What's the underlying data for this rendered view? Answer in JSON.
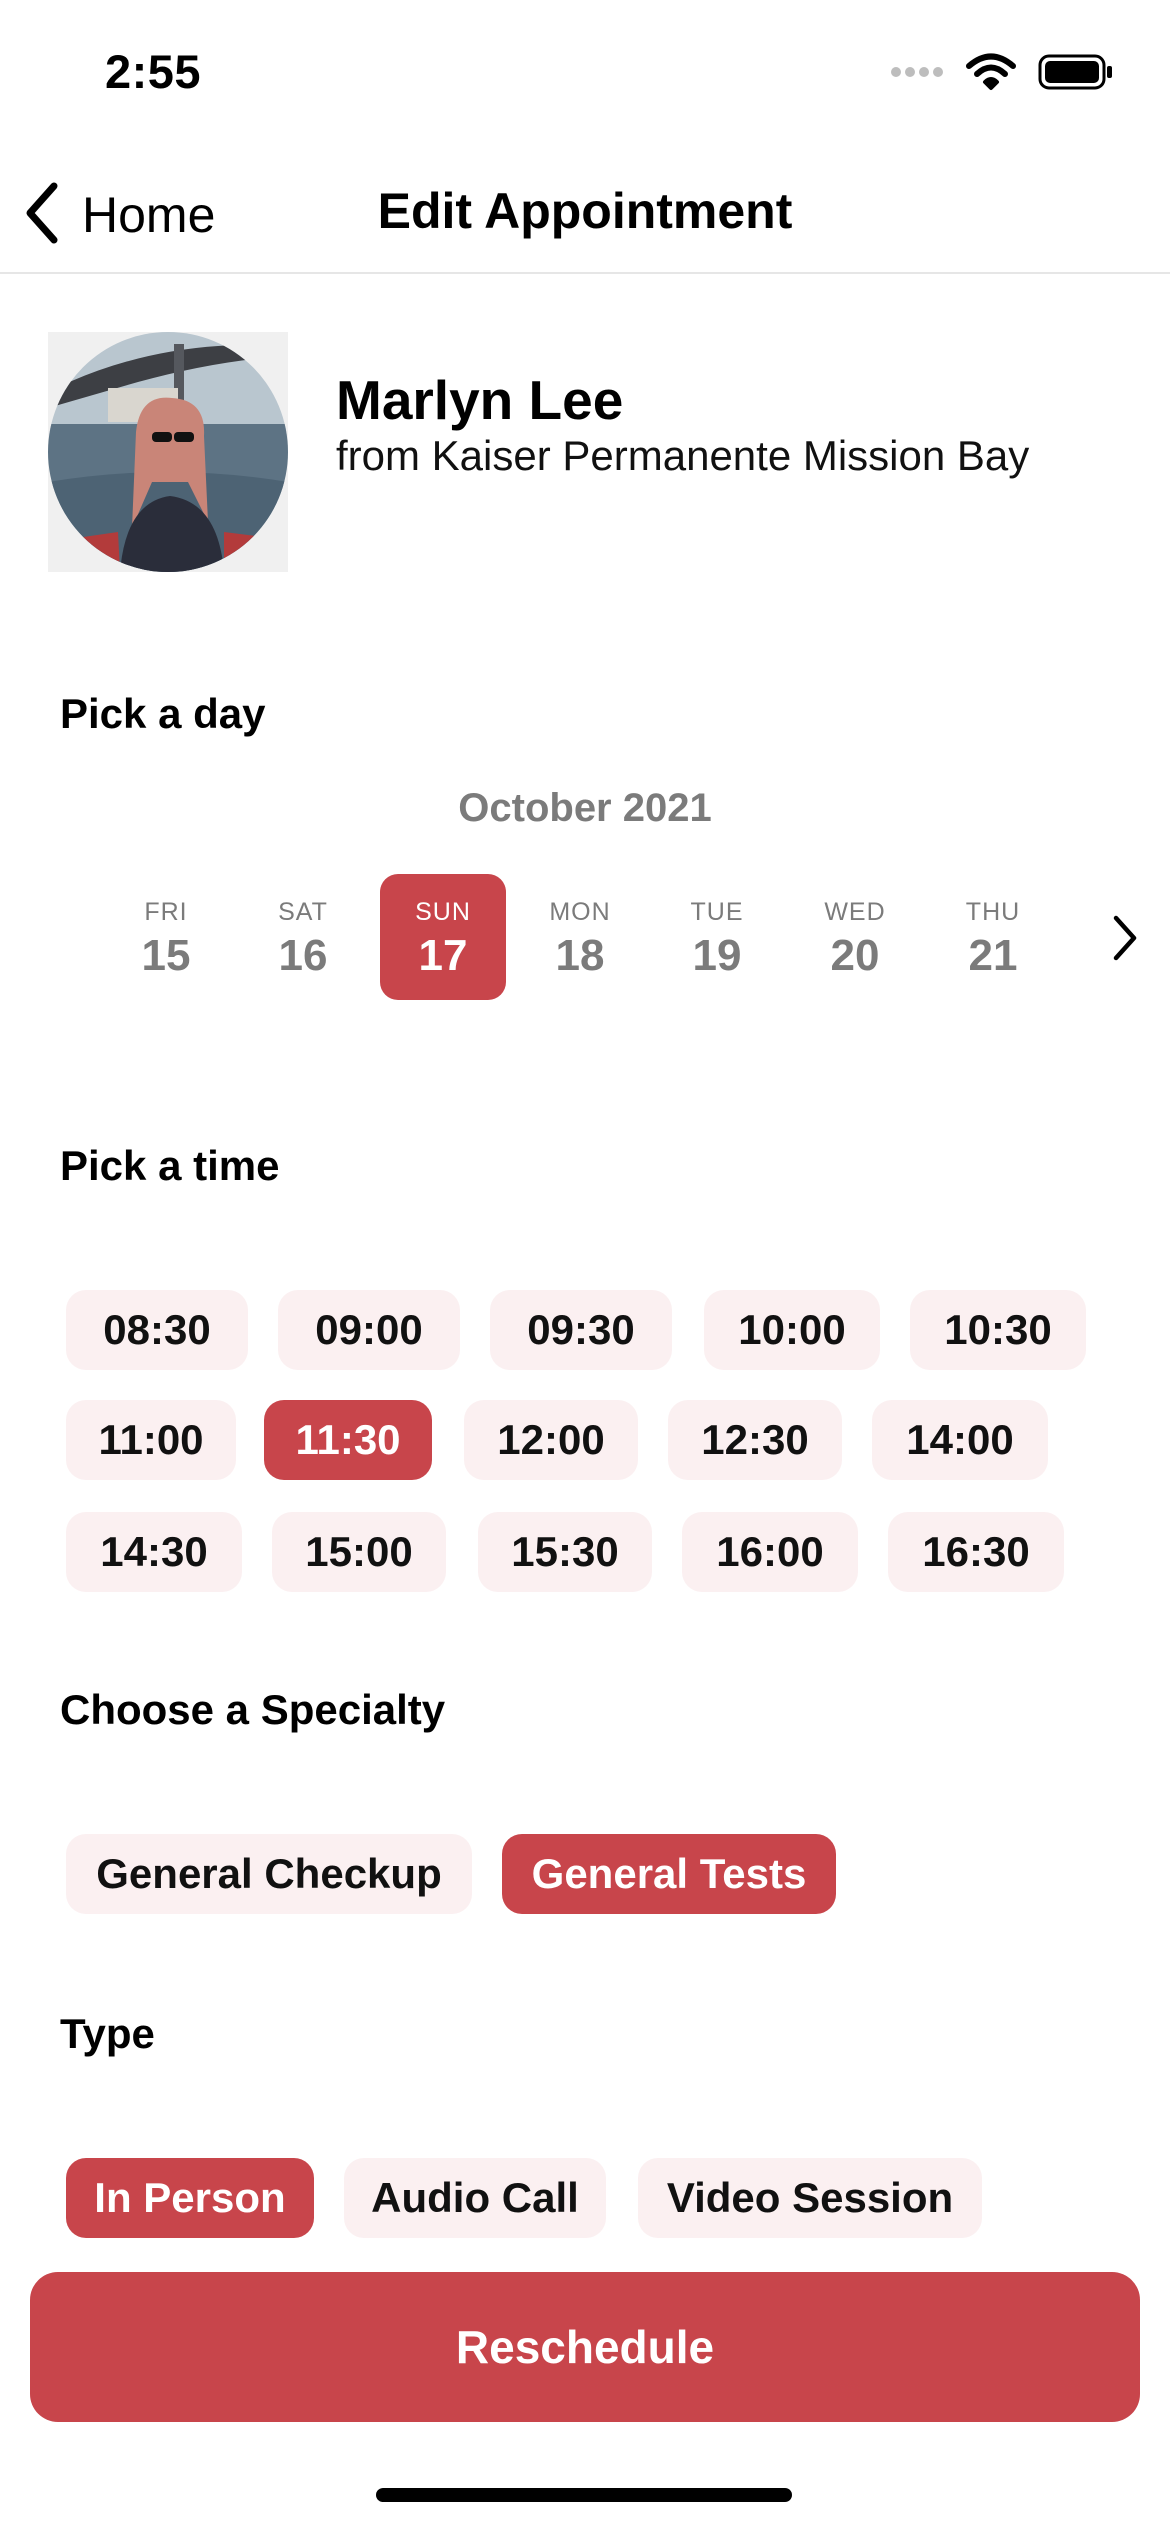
{
  "status_bar": {
    "time": "2:55"
  },
  "nav": {
    "back_label": "Home",
    "title": "Edit Appointment"
  },
  "doctor": {
    "name": "Marlyn Lee",
    "organization": "from Kaiser Permanente Mission Bay"
  },
  "day_section": {
    "label": "Pick a day",
    "month": "October 2021",
    "days": [
      {
        "dow": "FRI",
        "num": "15",
        "selected": false
      },
      {
        "dow": "SAT",
        "num": "16",
        "selected": false
      },
      {
        "dow": "SUN",
        "num": "17",
        "selected": true
      },
      {
        "dow": "MON",
        "num": "18",
        "selected": false
      },
      {
        "dow": "TUE",
        "num": "19",
        "selected": false
      },
      {
        "dow": "WED",
        "num": "20",
        "selected": false
      },
      {
        "dow": "THU",
        "num": "21",
        "selected": false
      }
    ]
  },
  "time_section": {
    "label": "Pick a time",
    "slots": [
      {
        "label": "08:30",
        "selected": false
      },
      {
        "label": "09:00",
        "selected": false
      },
      {
        "label": "09:30",
        "selected": false
      },
      {
        "label": "10:00",
        "selected": false
      },
      {
        "label": "10:30",
        "selected": false
      },
      {
        "label": "11:00",
        "selected": false
      },
      {
        "label": "11:30",
        "selected": true
      },
      {
        "label": "12:00",
        "selected": false
      },
      {
        "label": "12:30",
        "selected": false
      },
      {
        "label": "14:00",
        "selected": false
      },
      {
        "label": "14:30",
        "selected": false
      },
      {
        "label": "15:00",
        "selected": false
      },
      {
        "label": "15:30",
        "selected": false
      },
      {
        "label": "16:00",
        "selected": false
      },
      {
        "label": "16:30",
        "selected": false
      }
    ]
  },
  "specialty_section": {
    "label": "Choose a Specialty",
    "options": [
      {
        "label": "General Checkup",
        "selected": false
      },
      {
        "label": "General Tests",
        "selected": true
      }
    ]
  },
  "type_section": {
    "label": "Type",
    "options": [
      {
        "label": "In Person",
        "selected": true
      },
      {
        "label": "Audio Call",
        "selected": false
      },
      {
        "label": "Video Session",
        "selected": false
      }
    ]
  },
  "actions": {
    "reschedule_label": "Reschedule"
  },
  "colors": {
    "accent": "#c8454b",
    "chip_bg": "#fbf0f1",
    "muted_text": "#7b7b7b"
  },
  "icons": {
    "signal": "cellular-signal-icon",
    "wifi": "wifi-icon",
    "battery": "battery-icon",
    "back": "chevron-left-icon",
    "next": "chevron-right-icon"
  }
}
